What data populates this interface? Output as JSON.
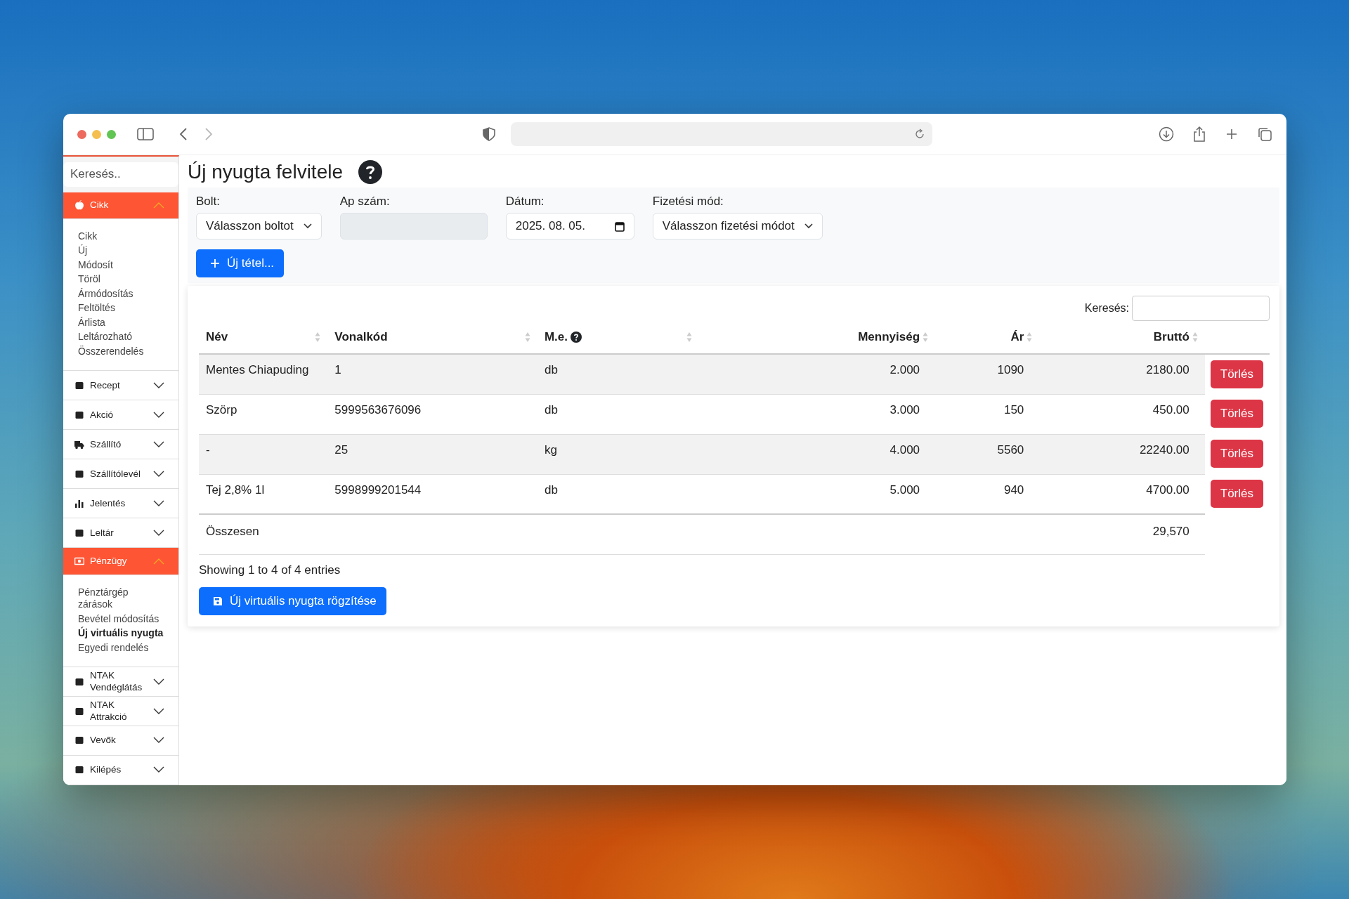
{
  "sidebar": {
    "search": {
      "placeholder": "Keresés.."
    },
    "sections": [
      {
        "label": "Cikk",
        "expanded": true,
        "children": [
          {
            "label": "Cikk",
            "selected": false
          },
          {
            "label": "Új",
            "selected": false
          },
          {
            "label": "Módosít",
            "selected": false
          },
          {
            "label": "Töröl",
            "selected": false
          },
          {
            "label": "Ármódosítás",
            "selected": false
          },
          {
            "label": "Feltöltés",
            "selected": false
          },
          {
            "label": "Árlista",
            "selected": false
          },
          {
            "label": "Leltározható",
            "selected": false
          },
          {
            "label": "Összerendelés",
            "selected": false
          }
        ]
      },
      {
        "label": "Recept",
        "expanded": false
      },
      {
        "label": "Akció",
        "expanded": false
      },
      {
        "label": "Szállító",
        "expanded": false
      },
      {
        "label": "Szállítólevél",
        "expanded": false
      },
      {
        "label": "Jelentés",
        "expanded": false
      },
      {
        "label": "Leltár",
        "expanded": false
      },
      {
        "label": "Pénzügy",
        "expanded": true,
        "children": [
          {
            "label": "Pénztárgép zárások",
            "selected": false
          },
          {
            "label": "Bevétel módosítás",
            "selected": false
          },
          {
            "label": "Új virtuális nyugta",
            "selected": true
          },
          {
            "label": "Egyedi rendelés",
            "selected": false
          }
        ]
      },
      {
        "label": "NTAK Vendéglátás",
        "expanded": false
      },
      {
        "label": "NTAK Attrakció",
        "expanded": false
      },
      {
        "label": "Vevők",
        "expanded": false
      },
      {
        "label": "Kilépés",
        "expanded": false
      }
    ]
  },
  "page": {
    "title": "Új nyugta felvitele",
    "form": {
      "fields": [
        {
          "label": "Bolt:",
          "kind": "select",
          "value": "Válasszon boltot"
        },
        {
          "label": "Ap szám:",
          "kind": "readonly"
        },
        {
          "label": "Dátum:",
          "kind": "date",
          "value": "2025. 08. 05."
        },
        {
          "label": "Fizetési mód:",
          "kind": "select",
          "value": "Válasszon fizetési módot"
        }
      ],
      "add_button": "Új tétel..."
    },
    "table": {
      "search_label": "Keresés:",
      "columns": [
        {
          "label": "Név",
          "help": false
        },
        {
          "label": "Vonalkód",
          "help": false
        },
        {
          "label": "M.e.",
          "help": true
        },
        {
          "label": "Mennyiség",
          "help": false
        },
        {
          "label": "Ár",
          "help": false
        },
        {
          "label": "Bruttó",
          "help": false
        }
      ],
      "rows": [
        {
          "cells": [
            "Mentes Chiapuding",
            "1",
            "db",
            "2.000",
            "1090",
            "2180.00"
          ],
          "action": "Törlés"
        },
        {
          "cells": [
            "Szörp",
            "5999563676096",
            "db",
            "3.000",
            "150",
            "450.00"
          ],
          "action": "Törlés"
        },
        {
          "cells": [
            "-",
            "25",
            "kg",
            "4.000",
            "5560",
            "22240.00"
          ],
          "action": "Törlés"
        },
        {
          "cells": [
            "Tej 2,8% 1l",
            "5998999201544",
            "db",
            "5.000",
            "940",
            "4700.00"
          ],
          "action": "Törlés"
        }
      ],
      "total_label": "Összesen",
      "total_value": "29,570",
      "info": "Showing 1 to 4 of 4 entries"
    },
    "save_button": "Új virtuális nyugta rögzítése"
  }
}
